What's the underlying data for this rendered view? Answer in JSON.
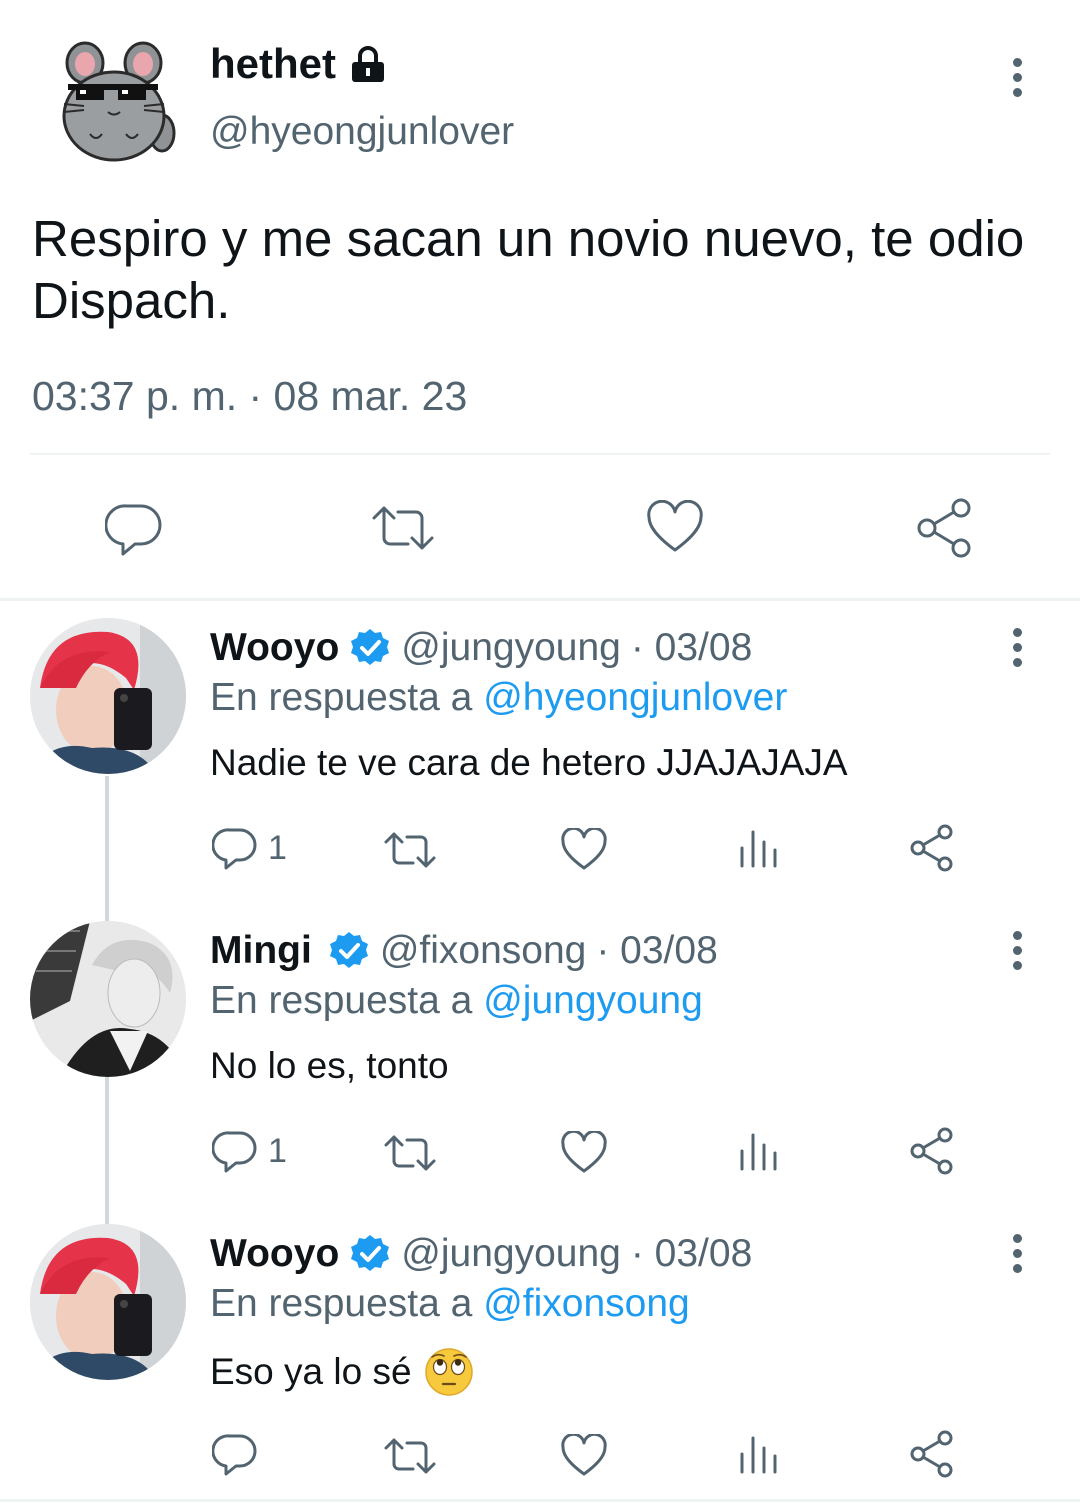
{
  "main_tweet": {
    "display_name": "hethet",
    "handle": "@hyeongjunlover",
    "text_line1": "Respiro y me sacan un novio nuevo, te odio",
    "text_line2": "Dispach.",
    "timestamp": "03:37 p. m. · 08 mar. 23",
    "avatar_icon": "chinchilla-sunglasses-avatar",
    "lock_icon": "lock-icon"
  },
  "replies": [
    {
      "display_name": "Wooyo",
      "handle": "@jungyoung",
      "date": "· 03/08",
      "reply_prefix": "En respuesta a",
      "reply_to": "@hyeongjunlover",
      "text": "Nadie te ve cara de hetero JJAJAJAJA",
      "reply_count": "1",
      "verified": true
    },
    {
      "display_name": "Mingi",
      "handle": "@fixonsong",
      "date": "· 03/08",
      "reply_prefix": "En respuesta a",
      "reply_to": "@jungyoung",
      "text": "No lo es, tonto",
      "reply_count": "1",
      "verified": true
    },
    {
      "display_name": "Wooyo",
      "handle": "@jungyoung",
      "date": "· 03/08",
      "reply_prefix": "En respuesta a",
      "reply_to": "@fixonsong",
      "text": "Eso ya lo sé",
      "emoji": "🙄",
      "reply_count": "",
      "verified": true
    }
  ],
  "colors": {
    "accent": "#1d9bf0",
    "secondary_text": "#536471",
    "divider": "#eff3f4"
  }
}
